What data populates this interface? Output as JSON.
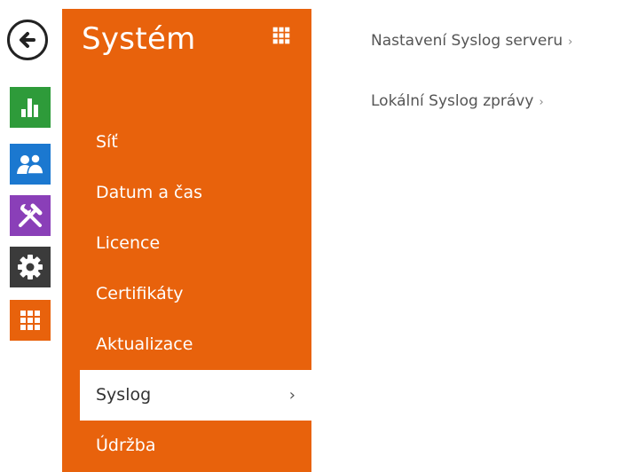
{
  "colors": {
    "accent": "#e8620c",
    "status_green": "#2e9b3a",
    "users_blue": "#1b78d0",
    "tools_purple": "#8a3fb8",
    "settings_dark": "#3b3b3b",
    "system_orange": "#e8620c"
  },
  "rail": {
    "back_icon": "arrow-left-circle-icon",
    "items": [
      {
        "icon": "status-bar-chart-icon"
      },
      {
        "icon": "users-icon"
      },
      {
        "icon": "tools-icon"
      },
      {
        "icon": "gear-icon"
      },
      {
        "icon": "grid-icon"
      }
    ]
  },
  "panel": {
    "title": "Systém",
    "title_icon": "grid-icon",
    "menu": [
      {
        "label": "Síť",
        "active": false
      },
      {
        "label": "Datum a čas",
        "active": false
      },
      {
        "label": "Licence",
        "active": false
      },
      {
        "label": "Certifikáty",
        "active": false
      },
      {
        "label": "Aktualizace",
        "active": false
      },
      {
        "label": "Syslog",
        "active": true,
        "chevron": "›"
      },
      {
        "label": "Údržba",
        "active": false
      }
    ]
  },
  "content": {
    "links": [
      {
        "label": "Nastavení Syslog serveru",
        "chevron": "›"
      },
      {
        "label": "Lokální Syslog zprávy",
        "chevron": "›"
      }
    ]
  }
}
